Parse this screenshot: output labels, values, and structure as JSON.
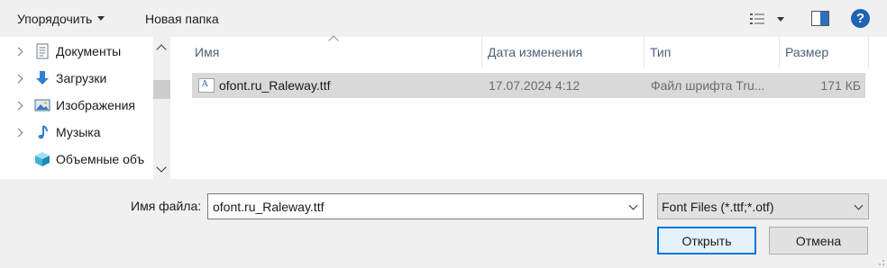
{
  "toolbar": {
    "organize_label": "Упорядочить",
    "new_folder_label": "Новая папка",
    "help_label": "?"
  },
  "nav": {
    "items": [
      {
        "label": "Документы",
        "icon": "documents-icon"
      },
      {
        "label": "Загрузки",
        "icon": "downloads-icon"
      },
      {
        "label": "Изображения",
        "icon": "pictures-icon"
      },
      {
        "label": "Музыка",
        "icon": "music-icon"
      },
      {
        "label": "Объемные объ",
        "icon": "3d-objects-icon"
      }
    ]
  },
  "columns": {
    "name": "Имя",
    "date": "Дата изменения",
    "type": "Тип",
    "size": "Размер"
  },
  "files": [
    {
      "name": "ofont.ru_Raleway.ttf",
      "date": "17.07.2024 4:12",
      "type": "Файл шрифта Tru...",
      "size": "171 КБ",
      "icon_glyph": "A"
    }
  ],
  "footer": {
    "filename_label": "Имя файла:",
    "filename_value": "ofont.ru_Raleway.ttf",
    "filter_value": "Font Files (*.ttf;*.otf)",
    "open_label": "Открыть",
    "cancel_label": "Отмена"
  },
  "colors": {
    "accent": "#0078d7",
    "selection": "#d9d9d9",
    "header_text": "#4c607a",
    "help_bg": "#1e64b4"
  }
}
